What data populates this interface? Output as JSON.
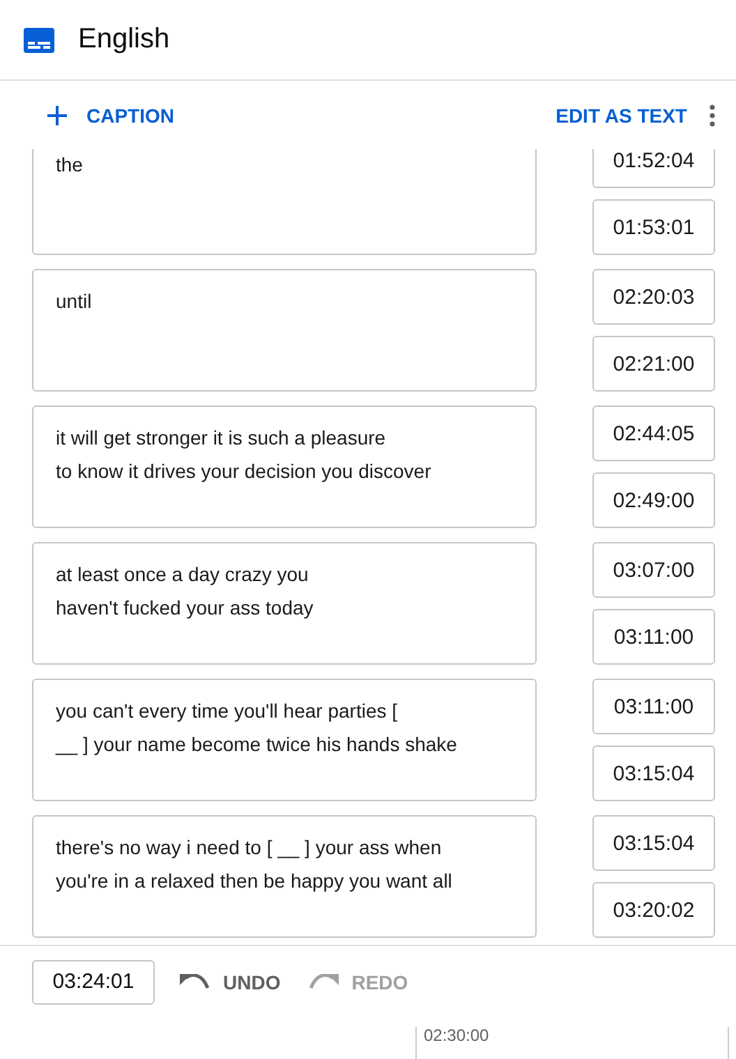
{
  "header": {
    "title": "English"
  },
  "toolbar": {
    "add_caption": "CAPTION",
    "edit_as_text": "EDIT AS TEXT"
  },
  "captions": [
    {
      "text": "the",
      "start": "01:52:04",
      "end": "01:53:01"
    },
    {
      "text": "until",
      "start": "02:20:03",
      "end": "02:21:00"
    },
    {
      "text": "it will get stronger it is such a pleasure\nto know it drives your decision you discover",
      "start": "02:44:05",
      "end": "02:49:00"
    },
    {
      "text": "at least once a day crazy you\nhaven't fucked your ass today",
      "start": "03:07:00",
      "end": "03:11:00"
    },
    {
      "text": "you can't every time you'll hear parties [\n__ ] your name become twice his hands shake",
      "start": "03:11:00",
      "end": "03:15:04"
    },
    {
      "text": "there's no way i need to [ __ ] your ass when\nyou're in a relaxed then be happy you want all",
      "start": "03:15:04",
      "end": "03:20:02"
    }
  ],
  "footer": {
    "current_time": "03:24:01",
    "undo": {
      "label": "UNDO",
      "disabled": false
    },
    "redo": {
      "label": "REDO",
      "disabled": true
    }
  },
  "timeline": {
    "ticks": [
      "02:30:00"
    ]
  }
}
